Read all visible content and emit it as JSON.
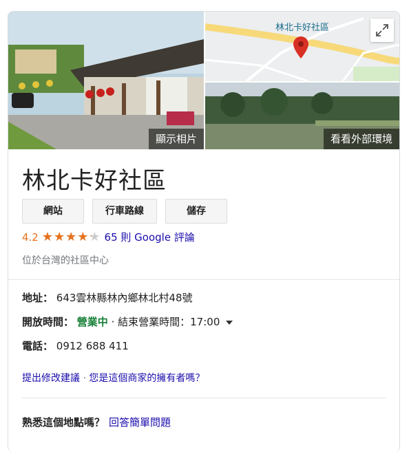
{
  "gallery": {
    "main_photo_label": "顯示相片",
    "street_view_label": "看看外部環境"
  },
  "map": {
    "title": "林北卡好社區"
  },
  "place": {
    "name": "林北卡好社區",
    "actions": {
      "website": "網站",
      "directions": "行車路線",
      "save": "儲存"
    },
    "rating": {
      "score": "4.2",
      "stars_value": 4.2,
      "stars_max": 5,
      "reviews_text": "65 則 Google 評論"
    },
    "category": "位於台灣的社區中心"
  },
  "details": {
    "address_label": "地址：",
    "address": "643雲林縣林內鄉林北村48號",
    "hours_label": "開放時間：",
    "hours_status": "營業中",
    "hours_detail": "· 結束營業時間：17:00",
    "phone_label": "電話：",
    "phone": "0912 688 411"
  },
  "suggest": {
    "edit_link": "提出修改建議",
    "separator": " · ",
    "owner_link": "您是這個商家的擁有者嗎？"
  },
  "know": {
    "question": "熟悉這個地點嗎？",
    "answer_link": "回答簡單問題"
  },
  "colors": {
    "star": "#e7711b",
    "link": "#1a0dab",
    "open": "#188038",
    "pin": "#d93025"
  },
  "icons": {
    "expand": "expand-icon",
    "pin": "map-pin-icon",
    "caret": "caret-down-icon"
  }
}
